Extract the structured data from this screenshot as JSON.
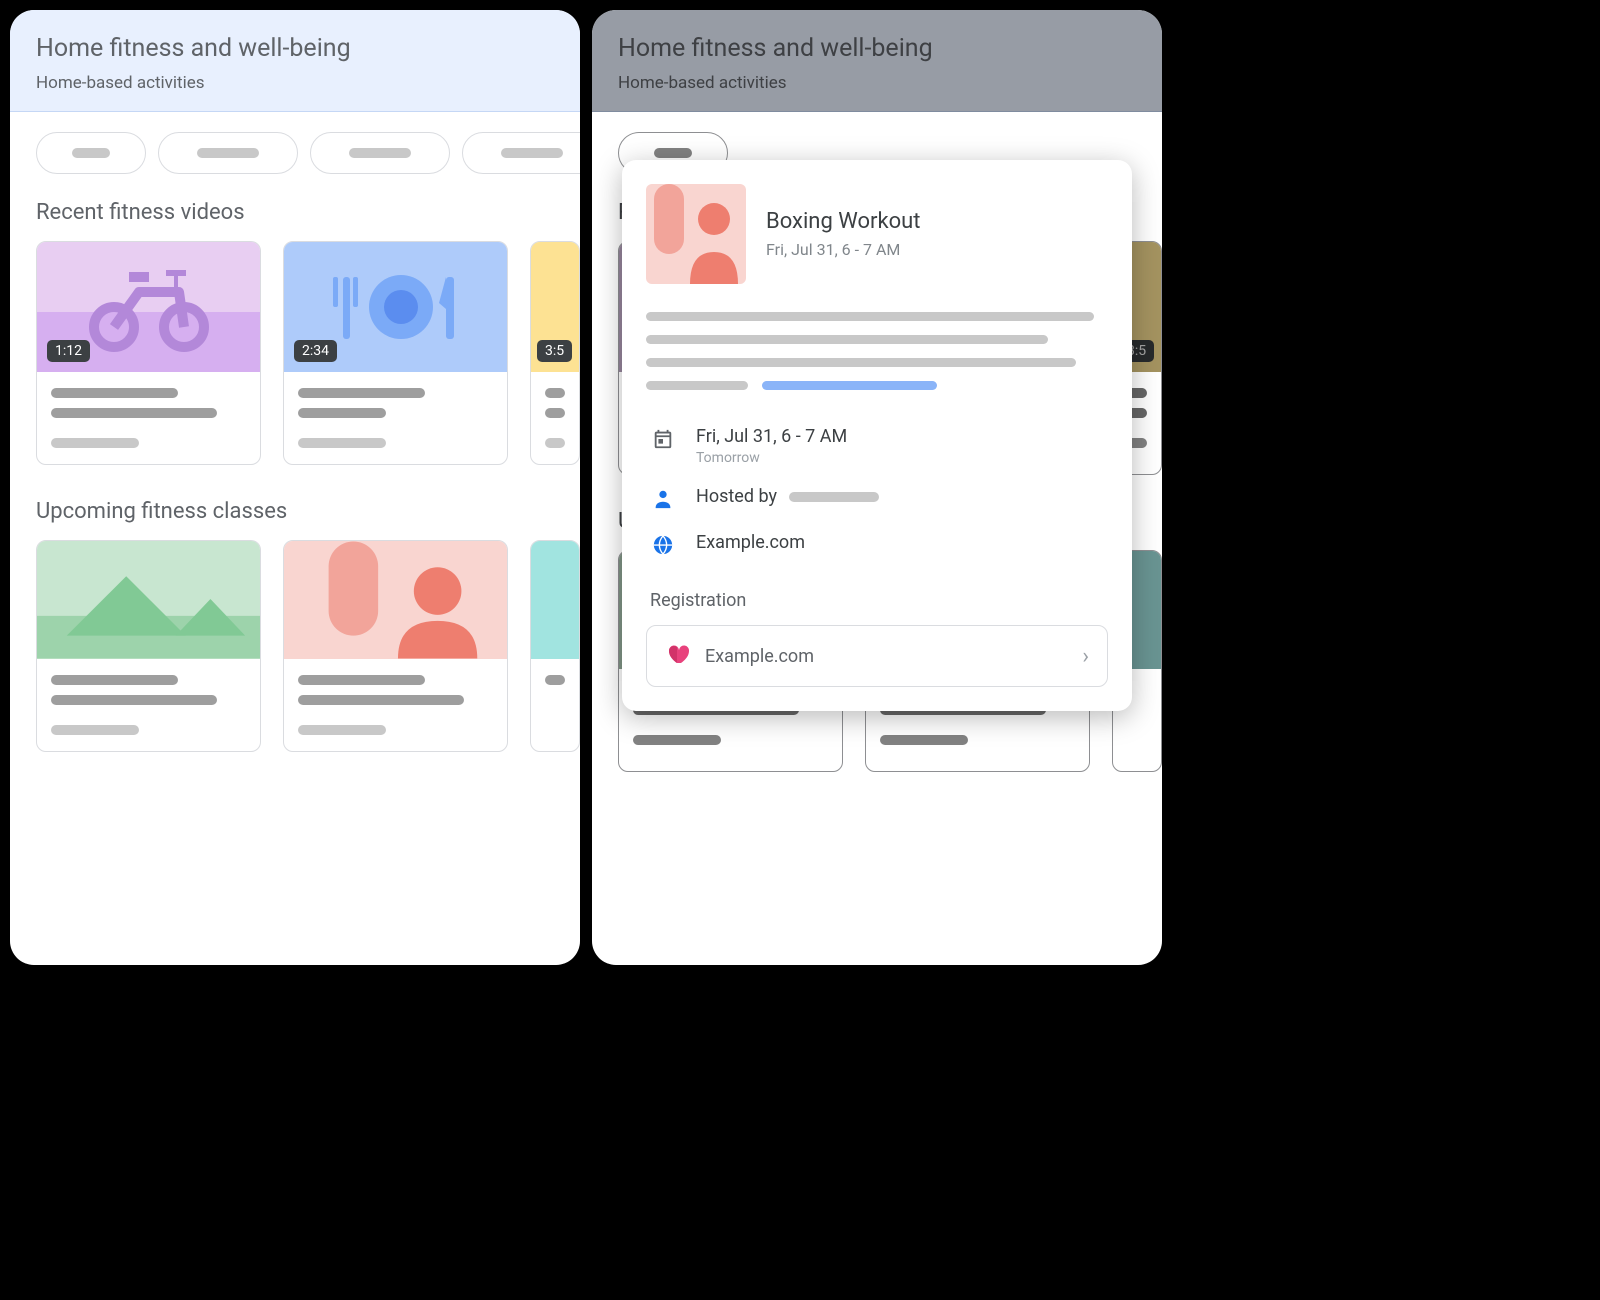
{
  "header": {
    "title": "Home fitness and well-being",
    "subtitle": "Home-based activities"
  },
  "sections": {
    "videos": {
      "title": "Recent fitness videos",
      "cards": [
        {
          "duration": "1:12",
          "icon": "bike"
        },
        {
          "duration": "2:34",
          "icon": "food"
        },
        {
          "duration": "3:5",
          "icon": "yellow"
        }
      ]
    },
    "classes": {
      "title": "Upcoming fitness classes",
      "cards": [
        {
          "icon": "mountains"
        },
        {
          "icon": "person"
        },
        {
          "icon": "teal"
        }
      ]
    }
  },
  "modal": {
    "title": "Boxing Workout",
    "subtitle": "Fri, Jul 31, 6 - 7 AM",
    "datetime": "Fri, Jul 31, 6 - 7 AM",
    "datetime_relative": "Tomorrow",
    "hosted_by_label": "Hosted by",
    "website": "Example.com",
    "registration_label": "Registration",
    "registration_site": "Example.com"
  }
}
